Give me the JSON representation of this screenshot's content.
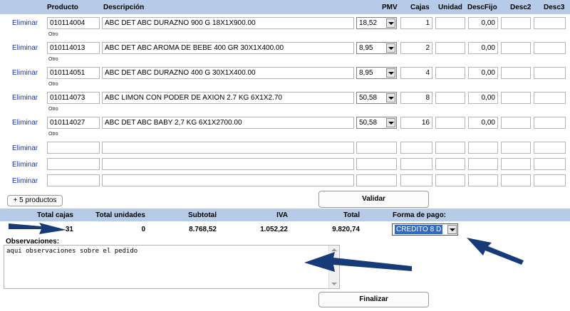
{
  "table": {
    "headers": {
      "producto": "Producto",
      "descripcion": "Descripción",
      "pmv": "PMV",
      "cajas": "Cajas",
      "unidad": "Unidad",
      "descfijo": "DescFijo",
      "desc2": "Desc2",
      "desc3": "Desc3"
    },
    "delete_label": "Eliminar",
    "otro_label": "Otro",
    "rows": [
      {
        "producto": "010114004",
        "descripcion": "ABC DET ABC DURAZNO 900 G 18X1X900.00",
        "pmv": "18,52",
        "cajas": "1",
        "descfijo": "0,00"
      },
      {
        "producto": "010114013",
        "descripcion": "ABC DET ABC AROMA DE BEBE 400 GR 30X1X400.00",
        "pmv": "8,95",
        "cajas": "2",
        "descfijo": "0,00"
      },
      {
        "producto": "010114051",
        "descripcion": "ABC DET ABC DURAZNO 400 G 30X1X400.00",
        "pmv": "8,95",
        "cajas": "4",
        "descfijo": "0,00"
      },
      {
        "producto": "010114073",
        "descripcion": "ABC LIMON CON PODER DE AXION 2.7 KG 6X1X2.70",
        "pmv": "50,58",
        "cajas": "8",
        "descfijo": "0,00"
      },
      {
        "producto": "010114027",
        "descripcion": "ABC DET ABC BABY 2,7 KG 6X1X2700.00",
        "pmv": "50,58",
        "cajas": "16",
        "descfijo": "0,00"
      }
    ]
  },
  "actions": {
    "add_products": "+ 5 productos",
    "validate": "Validar",
    "finalize": "Finalizar"
  },
  "totals": {
    "headers": {
      "total_cajas": "Total cajas",
      "total_unidades": "Total unidades",
      "subtotal": "Subtotal",
      "iva": "IVA",
      "total": "Total",
      "forma_pago": "Forma de pago:"
    },
    "values": {
      "total_cajas": "31",
      "total_unidades": "0",
      "subtotal": "8.768,52",
      "iva": "1.052,22",
      "total": "9.820,74"
    },
    "forma_pago_selected": "CREDITO 8 D"
  },
  "observaciones": {
    "label": "Observaciones:",
    "value": "aqui observaciones sobre el pedido"
  }
}
